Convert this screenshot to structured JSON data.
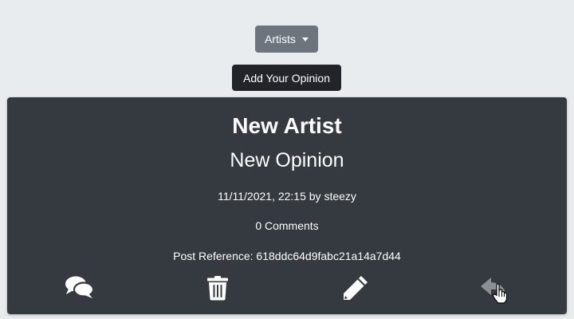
{
  "nav": {
    "dropdown_label": "Artists",
    "add_button_label": "Add Your Opinion"
  },
  "post": {
    "artist": "New Artist",
    "opinion": "New Opinion",
    "date_author": "11/11/2021, 22:15 by steezy",
    "comments": "0 Comments",
    "reference": "Post Reference: 618ddc64d9fabc21a14a7d44"
  },
  "actions": {
    "icons": [
      "comments-icon",
      "trash-icon",
      "pencil-icon",
      "reply-icon"
    ]
  },
  "colors": {
    "page_bg": "#e9ecef",
    "dropdown_bg": "#6c757d",
    "add_button_bg": "#212529",
    "card_bg": "#343a40",
    "text": "#ffffff",
    "disabled_icon": "#8a8f94"
  }
}
